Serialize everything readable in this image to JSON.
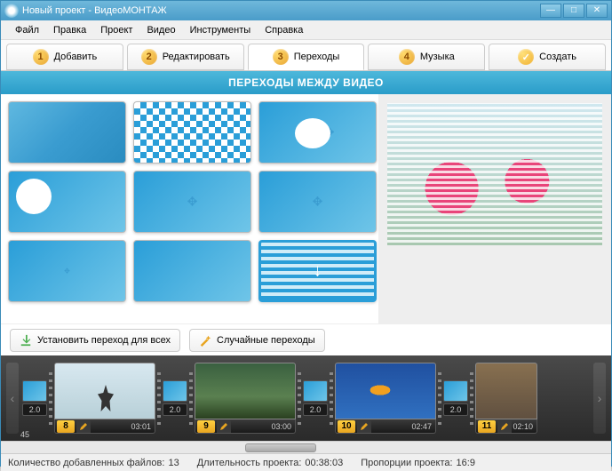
{
  "titlebar": {
    "text": "Новый проект - ВидеоМОНТАЖ"
  },
  "menu": {
    "file": "Файл",
    "edit": "Правка",
    "project": "Проект",
    "video": "Видео",
    "tools": "Инструменты",
    "help": "Справка"
  },
  "tabs": {
    "t1": {
      "num": "1",
      "label": "Добавить"
    },
    "t2": {
      "num": "2",
      "label": "Редактировать"
    },
    "t3": {
      "num": "3",
      "label": "Переходы"
    },
    "t4": {
      "num": "4",
      "label": "Музыка"
    },
    "t5": {
      "num": "✓",
      "label": "Создать"
    }
  },
  "header": {
    "title": "ПЕРЕХОДЫ МЕЖДУ ВИДЕО"
  },
  "actions": {
    "apply_all": "Установить переход для всех",
    "random": "Случайные переходы"
  },
  "timeline": {
    "prev_idx": "45",
    "trans_dur": "2.0",
    "clips": [
      {
        "num": "8",
        "time": "03:01"
      },
      {
        "num": "9",
        "time": "03:00"
      },
      {
        "num": "10",
        "time": "02:47"
      },
      {
        "num": "11",
        "time": "02:10"
      }
    ]
  },
  "status": {
    "files_label": "Количество добавленных файлов:",
    "files_count": "13",
    "duration_label": "Длительность проекта:",
    "duration_value": "00:38:03",
    "ratio_label": "Пропорции проекта:",
    "ratio_value": "16:9"
  }
}
